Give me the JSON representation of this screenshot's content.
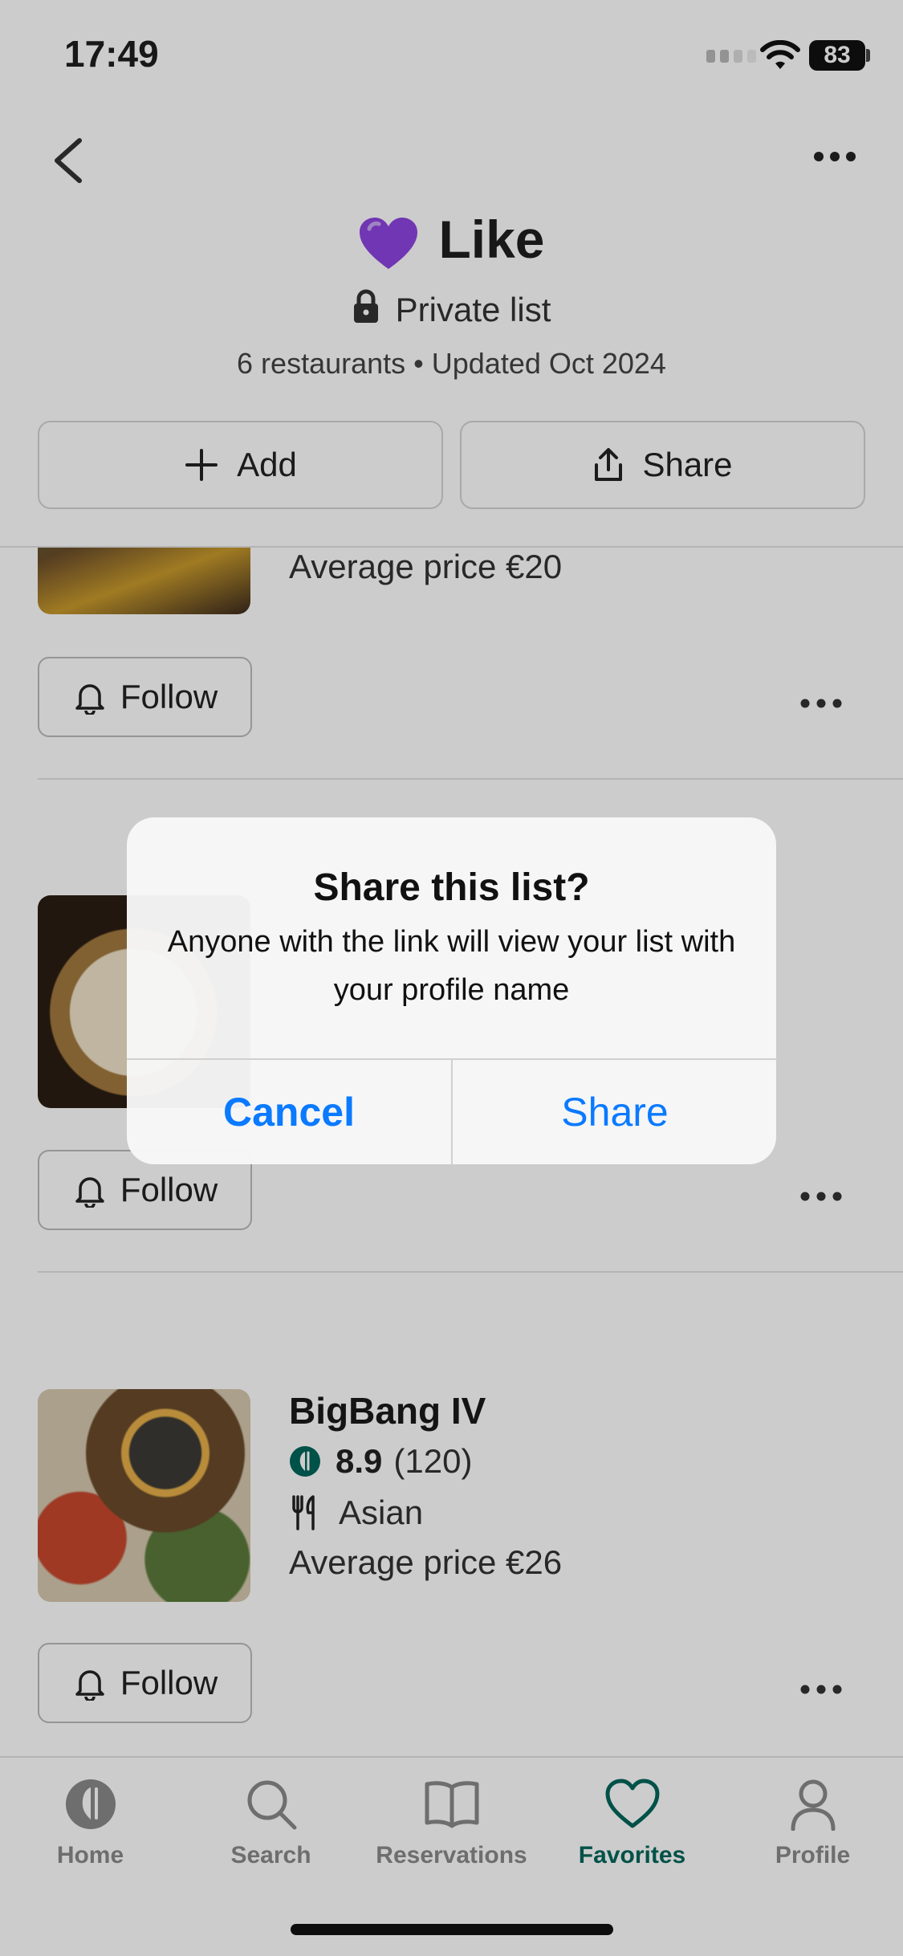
{
  "status_bar": {
    "time": "17:49",
    "battery": "83"
  },
  "header": {
    "title": "Like",
    "heart_icon": "purple-heart-icon",
    "privacy": "Private list",
    "meta": "6 restaurants • Updated Oct 2024",
    "add_label": "Add",
    "share_label": "Share"
  },
  "restaurants": [
    {
      "price": "Average price €20",
      "follow_label": "Follow"
    },
    {
      "follow_label": "Follow"
    },
    {
      "name": "BigBang IV",
      "rating": "8.9",
      "reviews": "(120)",
      "cuisine": "Asian",
      "price": "Average price €26",
      "follow_label": "Follow"
    }
  ],
  "dialog": {
    "title": "Share this list?",
    "message": "Anyone with the link will view your list with your profile name",
    "cancel_label": "Cancel",
    "share_label": "Share"
  },
  "tabs": [
    {
      "label": "Home",
      "icon": "home-fork-icon"
    },
    {
      "label": "Search",
      "icon": "search-icon"
    },
    {
      "label": "Reservations",
      "icon": "book-icon"
    },
    {
      "label": "Favorites",
      "icon": "heart-icon",
      "active": true
    },
    {
      "label": "Profile",
      "icon": "user-icon"
    }
  ],
  "colors": {
    "accent": "#00665a",
    "ios_blue": "#0a7aff",
    "heart": "#8e44e0"
  }
}
